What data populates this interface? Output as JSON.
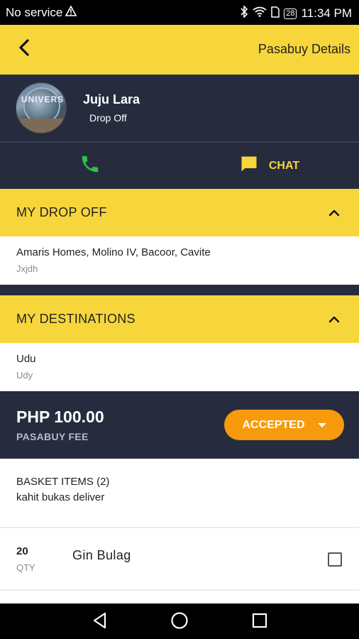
{
  "status_bar": {
    "carrier": "No service",
    "battery": "28",
    "time": "11:34 PM"
  },
  "app_bar": {
    "title": "Pasabuy Details"
  },
  "profile": {
    "name": "Juju Lara",
    "role": "Drop Off"
  },
  "contact": {
    "chat_label": "CHAT"
  },
  "drop_off": {
    "header": "MY DROP OFF",
    "address": "Amaris Homes, Molino IV, Bacoor, Cavite",
    "note": "Jxjdh"
  },
  "destinations": {
    "header": "MY DESTINATIONS",
    "address": "Udu",
    "note": "Udy"
  },
  "fee": {
    "amount": "PHP 100.00",
    "label": "PASABUY FEE",
    "status": "ACCEPTED"
  },
  "basket": {
    "header": "BASKET ITEMS (2)",
    "note": "kahit bukas deliver",
    "items": [
      {
        "qty": "20",
        "qty_label": "QTY",
        "name": "Gin Bulag"
      }
    ]
  },
  "colors": {
    "accent_yellow": "#f7d63b",
    "dark_navy": "#262c3e",
    "status_orange": "#f79a0c",
    "call_green": "#2fbf4a"
  }
}
